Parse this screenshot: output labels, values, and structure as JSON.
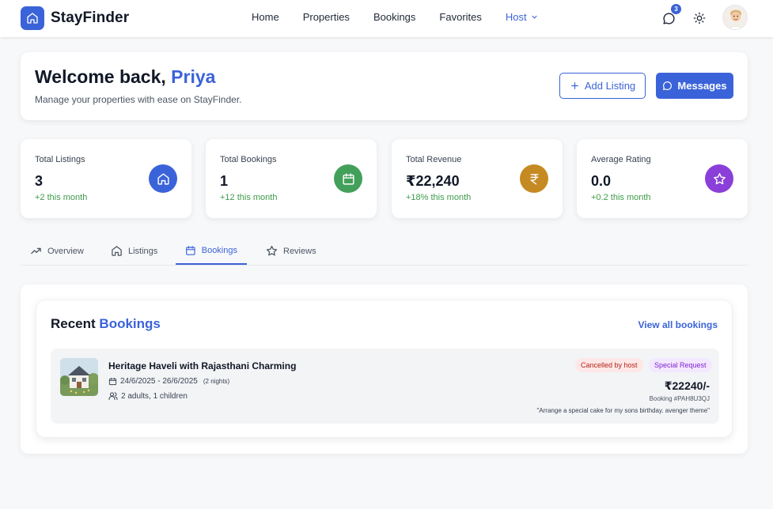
{
  "app": {
    "name": "StayFinder"
  },
  "nav": {
    "items": [
      "Home",
      "Properties",
      "Bookings",
      "Favorites"
    ],
    "host_label": "Host",
    "messages_badge": "3"
  },
  "welcome": {
    "greeting": "Welcome back, ",
    "user_name": "Priya",
    "subtitle": "Manage your properties with ease on StayFinder.",
    "add_listing_label": "Add Listing",
    "messages_label": "Messages"
  },
  "stats": [
    {
      "label": "Total Listings",
      "value": "3",
      "delta": "+2 this month",
      "icon": "home-icon",
      "color": "#3b63d9"
    },
    {
      "label": "Total Bookings",
      "value": "1",
      "delta": "+12 this month",
      "icon": "calendar-icon",
      "color": "#43a05b"
    },
    {
      "label": "Total Revenue",
      "value": "₹22,240",
      "delta": "+18% this month",
      "icon": "rupee-icon",
      "color": "#c68a23"
    },
    {
      "label": "Average Rating",
      "value": "0.0",
      "delta": "+0.2 this month",
      "icon": "star-icon",
      "color": "#8a3fd9"
    }
  ],
  "tabs": [
    {
      "label": "Overview",
      "icon": "trending-up-icon"
    },
    {
      "label": "Listings",
      "icon": "home-icon"
    },
    {
      "label": "Bookings",
      "icon": "calendar-icon",
      "active": true
    },
    {
      "label": "Reviews",
      "icon": "star-icon"
    }
  ],
  "recent": {
    "title_prefix": "Recent ",
    "title_highlight": "Bookings",
    "view_all_label": "View all bookings",
    "bookings": [
      {
        "title": "Heritage Haveli with Rajasthani Charming",
        "dates": "24/6/2025 - 26/6/2025",
        "nights": "(2 nights)",
        "guests": "2 adults, 1 children",
        "status": "Cancelled by host",
        "tag": "Special Request",
        "price": "₹22240/-",
        "booking_ref": "Booking #PAH8U3QJ",
        "note": "\"Arrange a special cake for my sons birthday. avenger theme\""
      }
    ]
  },
  "colors": {
    "accent": "#3b63d9",
    "success": "#3f9a4a"
  }
}
